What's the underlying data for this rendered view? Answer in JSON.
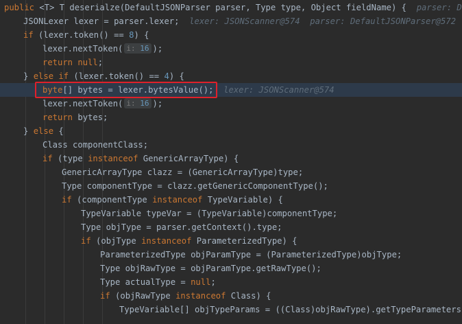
{
  "editor": {
    "lines": [
      {
        "segments": [
          {
            "t": "public",
            "c": "k"
          },
          {
            "t": " <T> T deserialze(DefaultJSONParser parser, Type type, Object fieldName) {  "
          },
          {
            "t": "parser: Default",
            "c": "hint"
          }
        ]
      },
      {
        "segments": [
          {
            "t": "JSONLexer lexer = parser.lexer;  "
          },
          {
            "t": "lexer: JSONScanner@574  parser: DefaultJSONParser@572",
            "c": "hint"
          }
        ]
      },
      {
        "segments": [
          {
            "t": "if",
            "c": "k"
          },
          {
            "t": " (lexer.token() == "
          },
          {
            "t": "8",
            "c": "n"
          },
          {
            "t": ") {"
          }
        ]
      },
      {
        "segments": [
          {
            "t": "lexer.nextToken("
          },
          {
            "box": "16",
            "label": "i:"
          },
          {
            "t": ");"
          }
        ]
      },
      {
        "segments": [
          {
            "t": "return null",
            "c": "k"
          },
          {
            "t": ";"
          }
        ]
      },
      {
        "segments": [
          {
            "t": "} "
          },
          {
            "t": "else if",
            "c": "k"
          },
          {
            "t": " (lexer.token() == "
          },
          {
            "t": "4",
            "c": "n"
          },
          {
            "t": ") {"
          }
        ]
      },
      {
        "segments": [
          {
            "t": "byte",
            "c": "k"
          },
          {
            "t": "[] bytes = lexer.bytesValue();  "
          },
          {
            "t": "lexer: JSONScanner@574",
            "c": "hint"
          }
        ]
      },
      {
        "segments": [
          {
            "t": "lexer.nextToken("
          },
          {
            "box": "16",
            "label": "i:"
          },
          {
            "t": ");"
          }
        ]
      },
      {
        "segments": [
          {
            "t": "return",
            "c": "k"
          },
          {
            "t": " bytes;"
          }
        ]
      },
      {
        "segments": [
          {
            "t": "} "
          },
          {
            "t": "else",
            "c": "k"
          },
          {
            "t": " {"
          }
        ]
      },
      {
        "segments": [
          {
            "t": "Class componentClass;"
          }
        ]
      },
      {
        "segments": [
          {
            "t": "if",
            "c": "k"
          },
          {
            "t": " (type "
          },
          {
            "t": "instanceof",
            "c": "k"
          },
          {
            "t": " GenericArrayType) {"
          }
        ]
      },
      {
        "segments": [
          {
            "t": "GenericArrayType clazz = (GenericArrayType)type;"
          }
        ]
      },
      {
        "segments": [
          {
            "t": "Type componentType = clazz.getGenericComponentType();"
          }
        ]
      },
      {
        "segments": [
          {
            "t": "if",
            "c": "k"
          },
          {
            "t": " (componentType "
          },
          {
            "t": "instanceof",
            "c": "k"
          },
          {
            "t": " TypeVariable) {"
          }
        ]
      },
      {
        "segments": [
          {
            "t": "TypeVariable typeVar = (TypeVariable)componentType;"
          }
        ]
      },
      {
        "segments": [
          {
            "t": "Type objType = parser.getContext().type;"
          }
        ]
      },
      {
        "segments": [
          {
            "t": "if",
            "c": "k"
          },
          {
            "t": " (objType "
          },
          {
            "t": "instanceof",
            "c": "k"
          },
          {
            "t": " ParameterizedType) {"
          }
        ]
      },
      {
        "segments": [
          {
            "t": "ParameterizedType objParamType = (ParameterizedType)objType;"
          }
        ]
      },
      {
        "segments": [
          {
            "t": "Type objRawType = objParamType.getRawType();"
          }
        ]
      },
      {
        "segments": [
          {
            "t": "Type actualType = "
          },
          {
            "t": "null",
            "c": "k"
          },
          {
            "t": ";"
          }
        ]
      },
      {
        "segments": [
          {
            "t": "if",
            "c": "k"
          },
          {
            "t": " (objRawType "
          },
          {
            "t": "instanceof",
            "c": "k"
          },
          {
            "t": " Class) {"
          }
        ]
      },
      {
        "segments": [
          {
            "t": "TypeVariable[] objTypeParams = ((Class)objRawType).getTypeParameters();"
          }
        ]
      }
    ]
  }
}
